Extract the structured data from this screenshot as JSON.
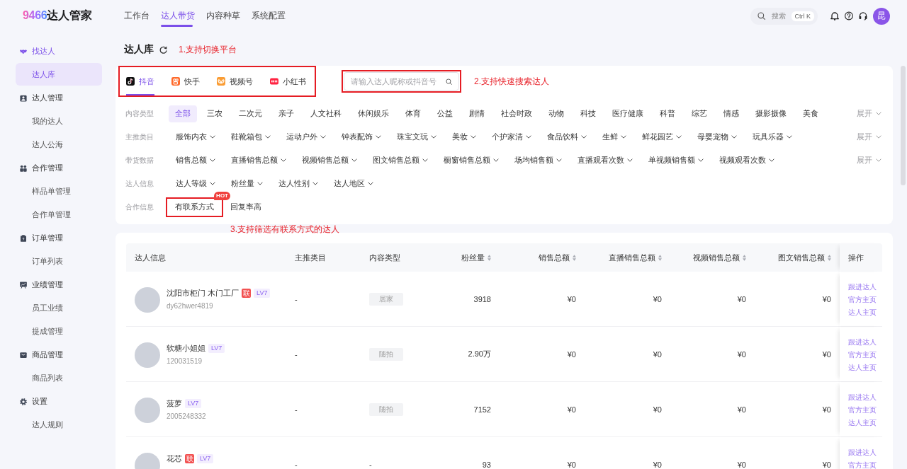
{
  "header": {
    "logo": {
      "digits": "9466",
      "name": "达人管家"
    },
    "nav": [
      {
        "label": "工作台",
        "selected": false
      },
      {
        "label": "达人带货",
        "selected": true
      },
      {
        "label": "内容种草",
        "selected": false
      },
      {
        "label": "系统配置",
        "selected": false
      }
    ],
    "search": {
      "placeholder": "搜索",
      "shortcut": "Ctrl K"
    },
    "avatar": "昆"
  },
  "sidebar": {
    "groups": [
      {
        "label": "找达人",
        "children": [
          {
            "label": "达人库",
            "selected": true
          }
        ]
      },
      {
        "label": "达人管理",
        "children": [
          {
            "label": "我的达人",
            "selected": false
          },
          {
            "label": "达人公海",
            "selected": false
          }
        ]
      },
      {
        "label": "合作管理",
        "children": [
          {
            "label": "样品单管理",
            "selected": false
          },
          {
            "label": "合作单管理",
            "selected": false
          }
        ]
      },
      {
        "label": "订单管理",
        "children": [
          {
            "label": "订单列表",
            "selected": false
          }
        ]
      },
      {
        "label": "业绩管理",
        "children": [
          {
            "label": "员工业绩",
            "selected": false
          },
          {
            "label": "提成管理",
            "selected": false
          }
        ]
      },
      {
        "label": "商品管理",
        "children": [
          {
            "label": "商品列表",
            "selected": false
          }
        ]
      },
      {
        "label": "设置",
        "children": [
          {
            "label": "达人规则",
            "selected": false
          }
        ]
      }
    ]
  },
  "page": {
    "title": "达人库",
    "annotation": "1.支持切换平台"
  },
  "filter_card": {
    "platform_tabs": {
      "highlighted": true,
      "tabs": [
        {
          "label": "抖音",
          "selected": true
        },
        {
          "label": "快手",
          "selected": false
        },
        {
          "label": "视频号",
          "selected": false
        },
        {
          "label": "小红书",
          "selected": false
        }
      ]
    },
    "search": {
      "placeholder": "请输入达人昵称或抖音号",
      "highlighted": true,
      "annotation": "2.支持快速搜索达人"
    },
    "filter_rows": [
      {
        "label": "内容类型",
        "kind": "chips",
        "options": [
          {
            "label": "全部",
            "selected": true
          },
          {
            "label": "三农",
            "selected": false
          },
          {
            "label": "二次元",
            "selected": false
          },
          {
            "label": "亲子",
            "selected": false
          },
          {
            "label": "人文社科",
            "selected": false
          },
          {
            "label": "休闲娱乐",
            "selected": false
          },
          {
            "label": "体育",
            "selected": false
          },
          {
            "label": "公益",
            "selected": false
          },
          {
            "label": "剧情",
            "selected": false
          },
          {
            "label": "社会时政",
            "selected": false
          },
          {
            "label": "动物",
            "selected": false
          },
          {
            "label": "科技",
            "selected": false
          },
          {
            "label": "医疗健康",
            "selected": false
          },
          {
            "label": "科普",
            "selected": false
          },
          {
            "label": "综艺",
            "selected": false
          },
          {
            "label": "情感",
            "selected": false
          },
          {
            "label": "摄影摄像",
            "selected": false
          },
          {
            "label": "美食",
            "selected": false
          }
        ],
        "expand": "展开"
      },
      {
        "label": "主推类目",
        "kind": "dropdowns",
        "options": [
          {
            "label": "服饰内衣"
          },
          {
            "label": "鞋靴箱包"
          },
          {
            "label": "运动户外"
          },
          {
            "label": "钟表配饰"
          },
          {
            "label": "珠宝文玩"
          },
          {
            "label": "美妆"
          },
          {
            "label": "个护家清"
          },
          {
            "label": "食品饮料"
          },
          {
            "label": "生鲜"
          },
          {
            "label": "鲜花园艺"
          },
          {
            "label": "母婴宠物"
          },
          {
            "label": "玩具乐器"
          }
        ],
        "expand": "展开"
      },
      {
        "label": "带货数据",
        "kind": "dropdowns",
        "options": [
          {
            "label": "销售总额"
          },
          {
            "label": "直播销售总额"
          },
          {
            "label": "视频销售总额"
          },
          {
            "label": "图文销售总额"
          },
          {
            "label": "橱窗销售总额"
          },
          {
            "label": "场均销售额"
          },
          {
            "label": "直播观看次数"
          },
          {
            "label": "单视频销售额"
          },
          {
            "label": "视频观看次数"
          }
        ],
        "expand": "展开"
      },
      {
        "label": "达人信息",
        "kind": "dropdowns",
        "options": [
          {
            "label": "达人等级"
          },
          {
            "label": "粉丝量"
          },
          {
            "label": "达人性别"
          },
          {
            "label": "达人地区"
          }
        ]
      },
      {
        "label": "合作信息",
        "kind": "chips",
        "options": [
          {
            "label": "有联系方式",
            "selected": false,
            "highlighted": true,
            "badge": "HOT"
          },
          {
            "label": "回复率高",
            "selected": false,
            "highlighted": false
          }
        ]
      }
    ],
    "annotation": "3.支持筛选有联系方式的达人"
  },
  "table": {
    "columns": [
      {
        "label": "达人信息",
        "kind": "creator",
        "sortable": false
      },
      {
        "label": "主推类目",
        "kind": "text",
        "sortable": false
      },
      {
        "label": "内容类型",
        "kind": "text",
        "sortable": false
      },
      {
        "label": "粉丝量",
        "kind": "number",
        "sortable": true
      },
      {
        "label": "销售总额",
        "kind": "number",
        "sortable": true
      },
      {
        "label": "直播销售总额",
        "kind": "number",
        "sortable": true
      },
      {
        "label": "视频销售总额",
        "kind": "number",
        "sortable": true
      },
      {
        "label": "图文销售总额",
        "kind": "number",
        "sortable": true
      },
      {
        "label": "操作",
        "kind": "actions",
        "sortable": false
      }
    ],
    "rows": [
      {
        "cells": [
          {
            "kind": "creator",
            "name": "沈阳市柜门 木门工厂",
            "contact": "联",
            "rank": "LV7",
            "account": "dy62hwer4819"
          },
          {
            "kind": "text",
            "text": "-"
          },
          {
            "kind": "tag",
            "text": "居家"
          },
          {
            "kind": "text",
            "text": "3918"
          },
          {
            "kind": "text",
            "text": "¥0"
          },
          {
            "kind": "text",
            "text": "¥0"
          },
          {
            "kind": "text",
            "text": "¥0"
          },
          {
            "kind": "text",
            "text": "¥0"
          },
          {
            "kind": "actions",
            "links": [
              "跟进达人",
              "官方主页",
              "达人主页"
            ]
          }
        ]
      },
      {
        "cells": [
          {
            "kind": "creator",
            "name": "软糖小姐姐",
            "rank": "LV7",
            "account": "120031519"
          },
          {
            "kind": "text",
            "text": "-"
          },
          {
            "kind": "tag",
            "text": "随拍"
          },
          {
            "kind": "text",
            "text": "2.90万"
          },
          {
            "kind": "text",
            "text": "¥0"
          },
          {
            "kind": "text",
            "text": "¥0"
          },
          {
            "kind": "text",
            "text": "¥0"
          },
          {
            "kind": "text",
            "text": "¥0"
          },
          {
            "kind": "actions",
            "links": [
              "跟进达人",
              "官方主页",
              "达人主页"
            ]
          }
        ]
      },
      {
        "cells": [
          {
            "kind": "creator",
            "name": "菠萝",
            "rank": "LV7",
            "account": "2005248332"
          },
          {
            "kind": "text",
            "text": "-"
          },
          {
            "kind": "tag",
            "text": "随拍"
          },
          {
            "kind": "text",
            "text": "7152"
          },
          {
            "kind": "text",
            "text": "¥0"
          },
          {
            "kind": "text",
            "text": "¥0"
          },
          {
            "kind": "text",
            "text": "¥0"
          },
          {
            "kind": "text",
            "text": "¥0"
          },
          {
            "kind": "actions",
            "links": [
              "跟进达人",
              "官方主页",
              "达人主页"
            ]
          }
        ]
      },
      {
        "cells": [
          {
            "kind": "creator",
            "name": "花芯",
            "contact": "联",
            "rank": "LV7"
          },
          {
            "kind": "text",
            "text": "-"
          },
          {
            "kind": "text",
            "text": "-"
          },
          {
            "kind": "text",
            "text": "93"
          },
          {
            "kind": "text",
            "text": "¥0"
          },
          {
            "kind": "text",
            "text": "¥0"
          },
          {
            "kind": "text",
            "text": "¥0"
          },
          {
            "kind": "text",
            "text": "¥0"
          },
          {
            "kind": "actions",
            "links": [
              "跟进达人",
              "官方主页"
            ]
          }
        ]
      }
    ]
  }
}
